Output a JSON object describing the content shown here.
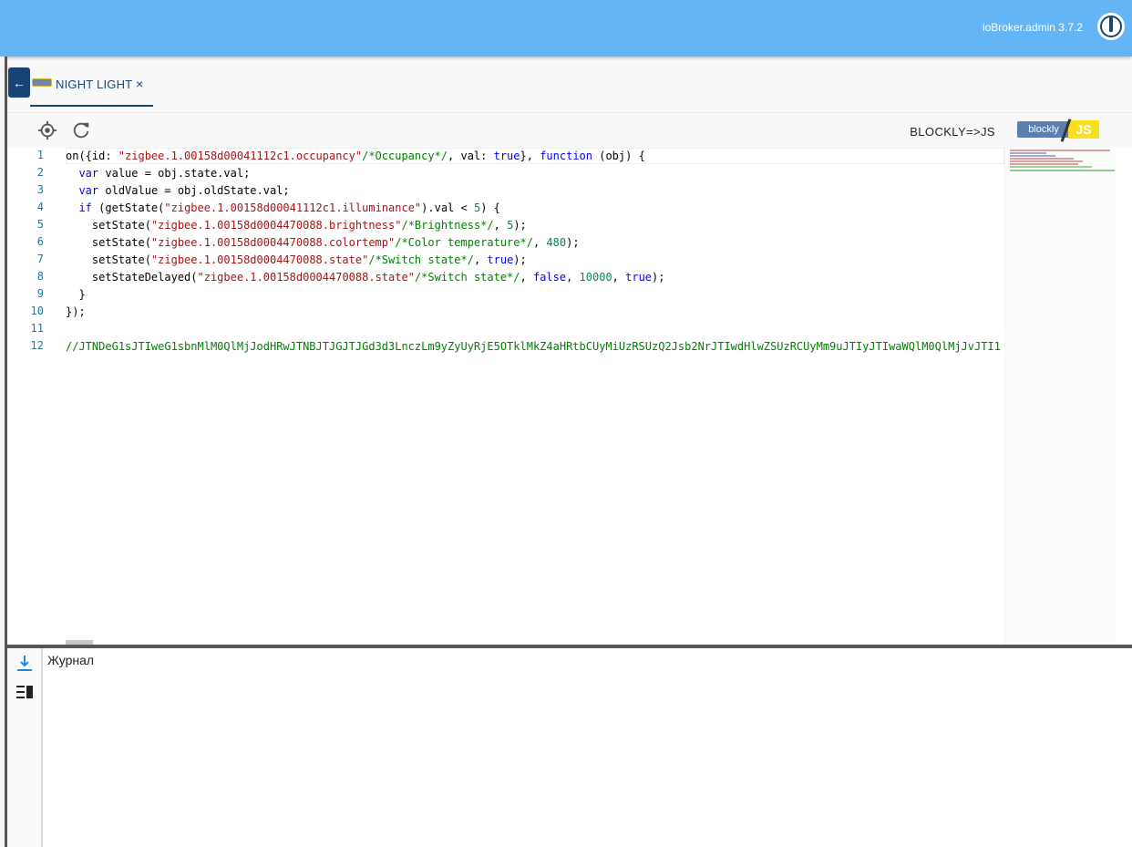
{
  "header": {
    "version": "ioBroker.admin 3.7.2",
    "logo_icon": "iobroker-logo-icon",
    "bg_color": "#64b5f6"
  },
  "tabs": [
    {
      "label": "NIGHT LIGHT",
      "close": "×",
      "icon": "blockly-script-icon"
    }
  ],
  "toolbar": {
    "convert_label": "BLOCKLY=>JS",
    "blockly_badge": {
      "left": "blockly",
      "right": "JS"
    }
  },
  "editor": {
    "line_numbers": [
      "1",
      "2",
      "3",
      "4",
      "5",
      "6",
      "7",
      "8",
      "9",
      "10",
      "11",
      "12"
    ]
  },
  "log": {
    "title": "Журнал"
  },
  "colors": {
    "accent": "#174475",
    "keyword": "#0000ff",
    "string": "#a31515",
    "comment": "#008000",
    "number": "#098658",
    "line_number": "#237893"
  }
}
